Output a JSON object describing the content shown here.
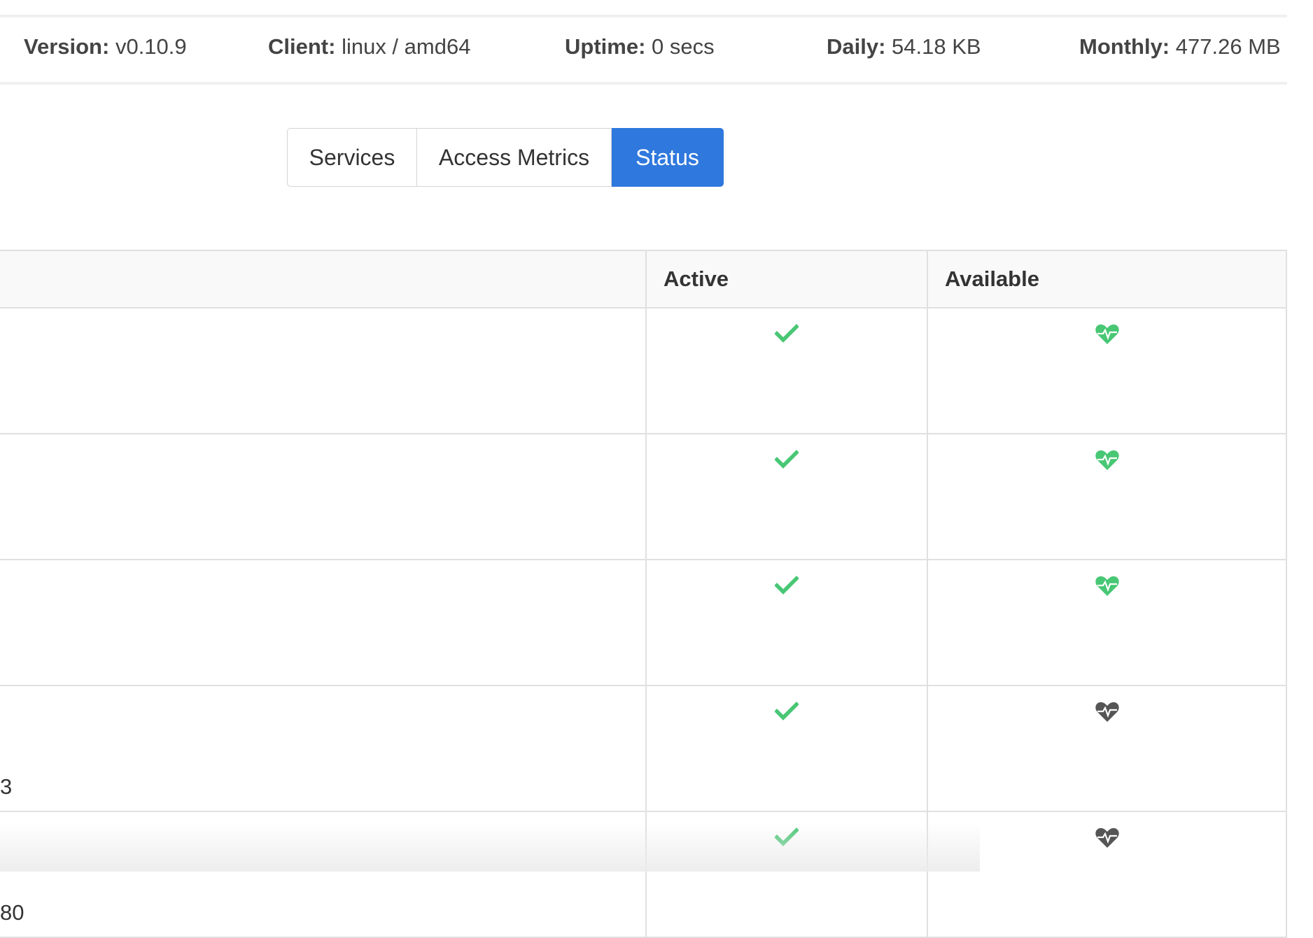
{
  "status_bar": {
    "version_label": "Version:",
    "version": "v0.10.9",
    "client_label": "Client:",
    "client": "linux / amd64",
    "uptime_label": "Uptime:",
    "uptime": "0 secs",
    "daily_label": "Daily:",
    "daily": "54.18 KB",
    "monthly_label": "Monthly:",
    "monthly": "477.26 MB"
  },
  "tabs": [
    {
      "label": "Services",
      "active": false
    },
    {
      "label": "Access Metrics",
      "active": false
    },
    {
      "label": "Status",
      "active": true
    }
  ],
  "table": {
    "headers": [
      "",
      "Active",
      "Available"
    ],
    "rows": [
      {
        "text": "",
        "active": "check-icon",
        "available": "heartbeat-icon",
        "available_color": "#48c774"
      },
      {
        "text": "",
        "active": "check-icon",
        "available": "heartbeat-icon",
        "available_color": "#48c774"
      },
      {
        "text": "",
        "active": "check-icon",
        "available": "heartbeat-icon",
        "available_color": "#48c774"
      },
      {
        "text": "3",
        "active": "check-icon",
        "available": "heartbeat-icon",
        "available_color": "#555555"
      },
      {
        "text": "80",
        "active": "check-icon",
        "available": "heartbeat-icon",
        "available_color": "#555555"
      }
    ]
  },
  "colors": {
    "accent": "#2f78dd",
    "ok": "#48c774",
    "unavailable": "#555555"
  }
}
